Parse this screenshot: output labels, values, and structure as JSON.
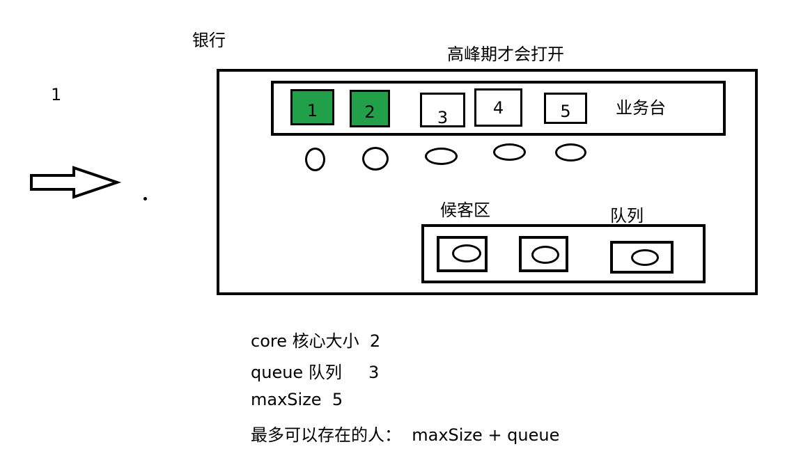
{
  "side_label": "1",
  "bank": {
    "title": "银行",
    "peak_note": "高峰期才会打开",
    "counters_label": "业务台",
    "counters": [
      {
        "label": "1",
        "open": true
      },
      {
        "label": "2",
        "open": true
      },
      {
        "label": "3",
        "open": false
      },
      {
        "label": "4",
        "open": false
      },
      {
        "label": "5",
        "open": false
      }
    ],
    "waiting_area_label": "候客区",
    "queue_label": "队列"
  },
  "notes": [
    "core 核心大小  2",
    "queue 队列     3",
    "maxSize  5",
    "最多可以存在的人：  maxSize + queue"
  ]
}
